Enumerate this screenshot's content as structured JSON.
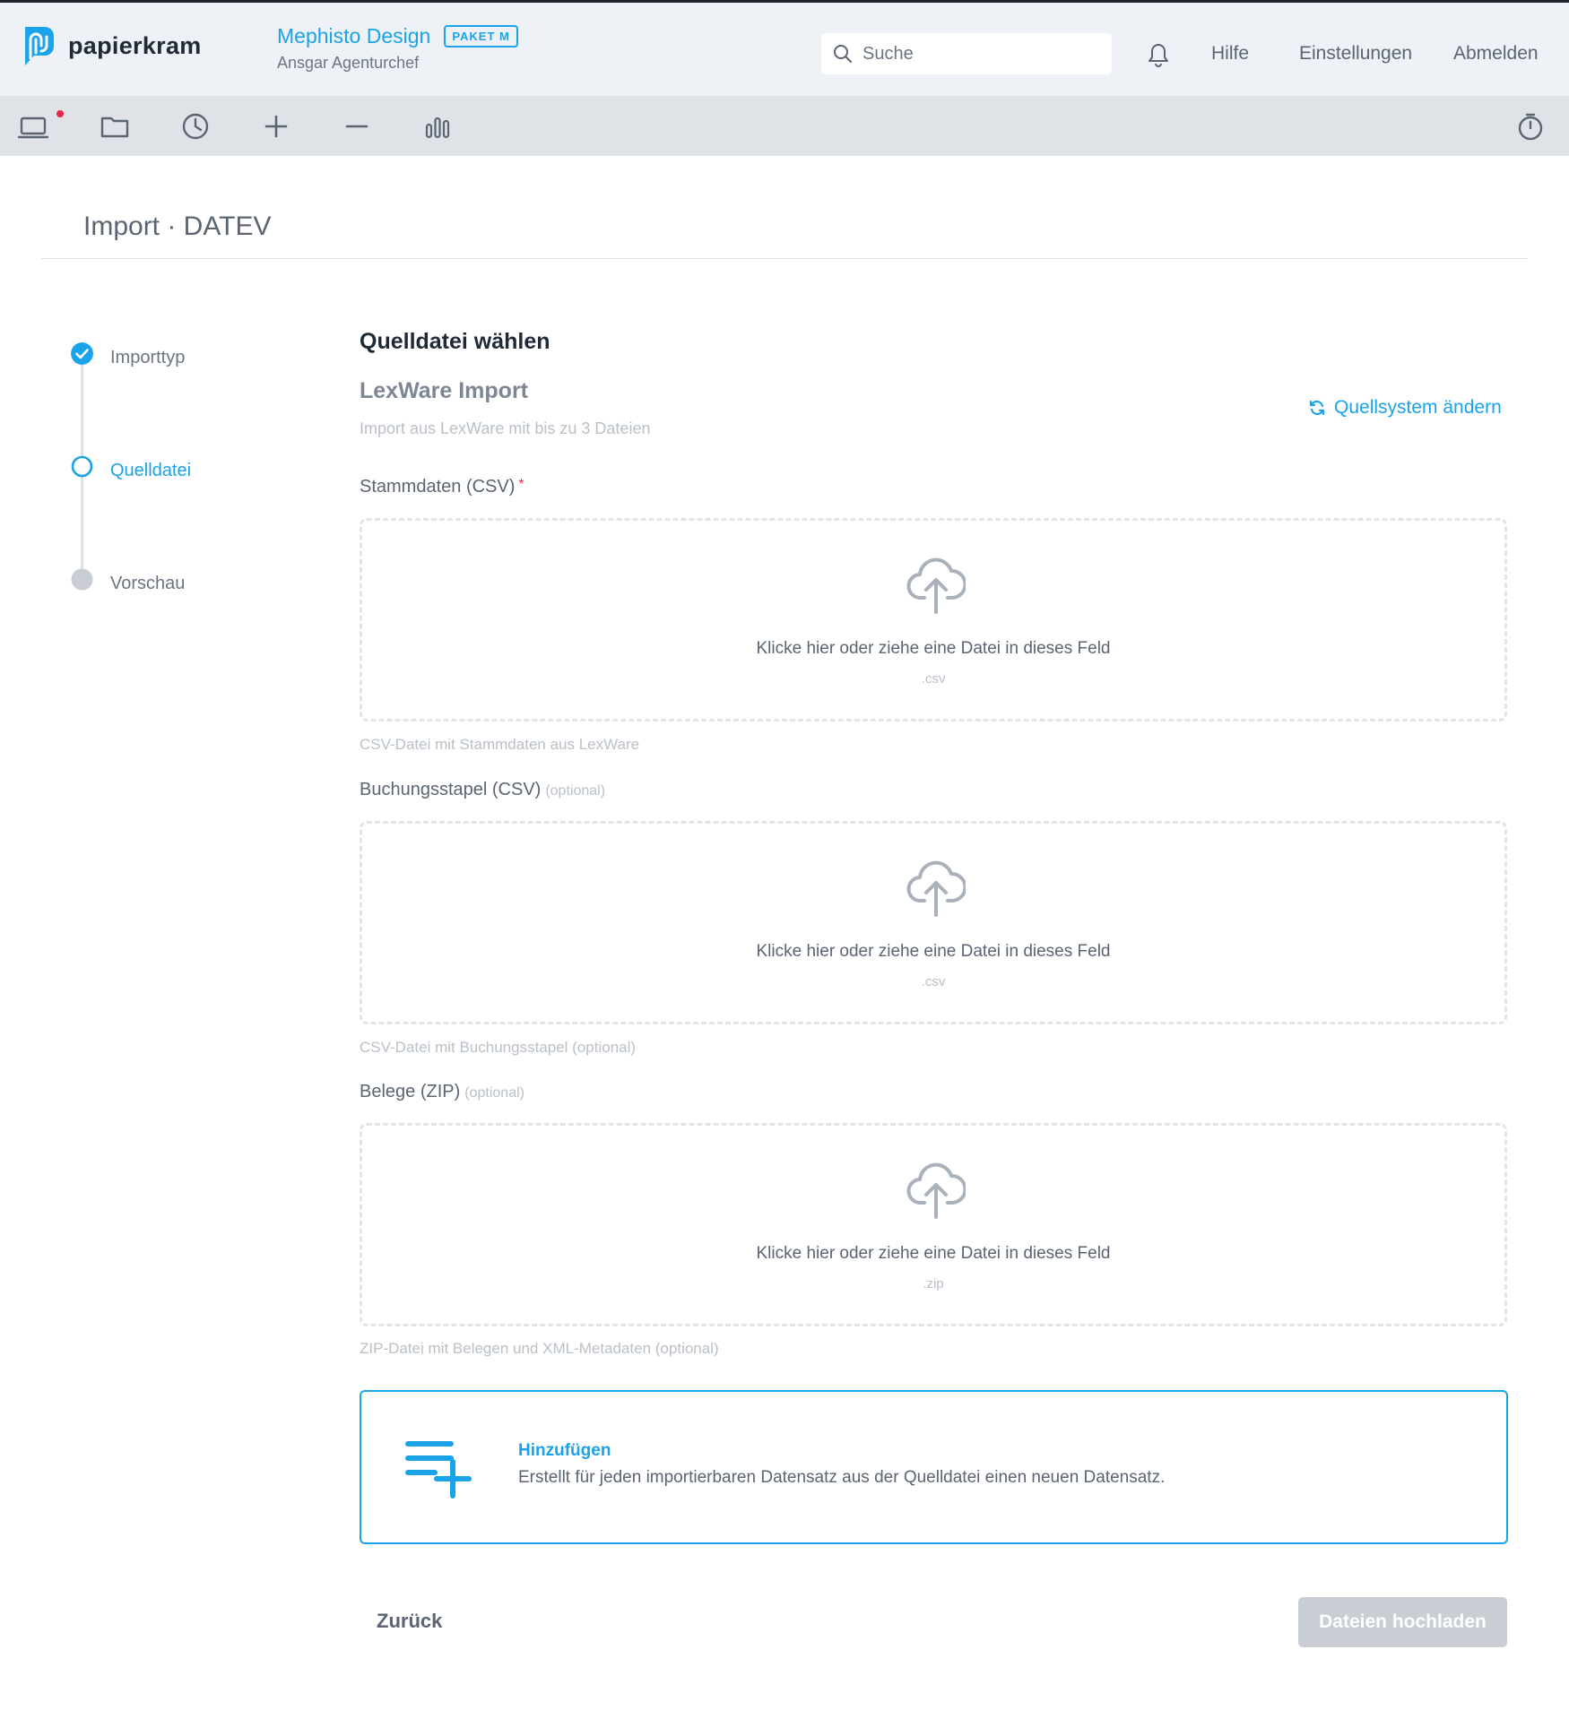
{
  "header": {
    "logo_text": "papierkram",
    "company_name": "Mephisto Design",
    "plan_badge": "PAKET M",
    "user_name": "Ansgar Agenturchef",
    "search_placeholder": "Suche",
    "nav": [
      "Hilfe",
      "Einstellungen",
      "Abmelden"
    ]
  },
  "toolbar": {
    "icons": [
      "laptop-icon",
      "folder-icon",
      "clock-icon",
      "plus-icon",
      "minus-icon",
      "bar-chart-icon",
      "stopwatch-icon"
    ],
    "notification_dot_color": "#e8254a"
  },
  "page": {
    "title": "Import · DATEV"
  },
  "stepper": {
    "steps": [
      {
        "label": "Importtyp",
        "state": "done"
      },
      {
        "label": "Quelldatei",
        "state": "active"
      },
      {
        "label": "Vorschau",
        "state": "pending"
      }
    ]
  },
  "main": {
    "heading": "Quelldatei wählen",
    "subheading": "LexWare Import",
    "description": "Import aus LexWare mit bis zu 3 Dateien",
    "change_source": "Quellsystem ändern",
    "fields": [
      {
        "label": "Stammdaten (CSV)",
        "required_mark": "*",
        "optional_text": "",
        "dropzone_text": "Klicke hier oder ziehe eine Datei in dieses Feld",
        "extension": ".csv",
        "help": "CSV-Datei mit Stammdaten aus LexWare"
      },
      {
        "label": "Buchungsstapel (CSV)",
        "required_mark": "",
        "optional_text": "(optional)",
        "dropzone_text": "Klicke hier oder ziehe eine Datei in dieses Feld",
        "extension": ".csv",
        "help": "CSV-Datei mit Buchungsstapel (optional)"
      },
      {
        "label": "Belege (ZIP)",
        "required_mark": "",
        "optional_text": "(optional)",
        "dropzone_text": "Klicke hier oder ziehe eine Datei in dieses Feld",
        "extension": ".zip",
        "help": "ZIP-Datei mit Belegen und XML-Metadaten (optional)"
      }
    ],
    "import_option": {
      "title": "Hinzufügen",
      "description": "Erstellt für jeden importierbaren Datensatz aus der Quelldatei einen neuen Datensatz."
    }
  },
  "footer": {
    "back_label": "Zurück",
    "upload_label": "Dateien hochladen"
  },
  "colors": {
    "accent": "#1aa3e8",
    "required": "#e8254a",
    "button_disabled": "#c8ced4"
  }
}
